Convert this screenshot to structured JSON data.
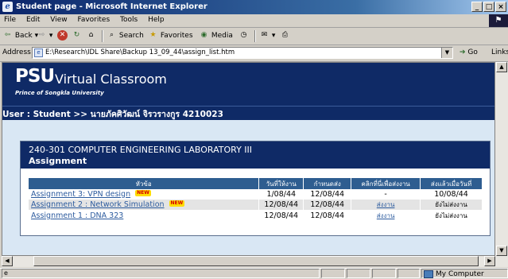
{
  "window": {
    "title": "Student page - Microsoft Internet Explorer",
    "controls": [
      "_",
      "□",
      "×"
    ]
  },
  "menu": [
    "File",
    "Edit",
    "View",
    "Favorites",
    "Tools",
    "Help"
  ],
  "toolbar": {
    "back": "Back",
    "search": "Search",
    "favorites": "Favorites",
    "media": "Media"
  },
  "address": {
    "label": "Address",
    "url": "E:\\Research\\IDL Share\\Backup 13_09_44\\assign_list.htm",
    "go": "Go",
    "links": "Links"
  },
  "banner": {
    "logo": "PSU",
    "title": "Virtual Classroom",
    "subtitle": "Prince of Songkla University"
  },
  "user": {
    "text": "User : Student >> นายภัคศิวัฒน์ จิรวรางกูร 4210023"
  },
  "course": {
    "title": "240-301 COMPUTER ENGINEERING LABORATORY III",
    "section": "Assignment"
  },
  "table": {
    "headers": [
      "หัวข้อ",
      "วันที่ให้งาน",
      "กำหนดส่ง",
      "คลิกที่นี่เพื่อส่งงาน",
      "ส่งแล้วเมื่อวันที่"
    ],
    "rows": [
      {
        "name": "Assignment 3: VPN design",
        "is_new": true,
        "assigned": "1/08/44",
        "due": "12/08/44",
        "submit": "-",
        "submitted": "10/08/44"
      },
      {
        "name": "Assignment 2 : Network Simulation",
        "is_new": true,
        "assigned": "12/08/44",
        "due": "12/08/44",
        "submit": "ส่งงาน",
        "submitted": "ยังไม่ส่งงาน"
      },
      {
        "name": "Assignment 1 : DNA 323",
        "is_new": false,
        "assigned": "12/08/44",
        "due": "12/08/44",
        "submit": "ส่งงาน",
        "submitted": "ยังไม่ส่งงาน"
      }
    ],
    "new_badge": "NEW"
  },
  "status": {
    "zone": "My Computer"
  }
}
